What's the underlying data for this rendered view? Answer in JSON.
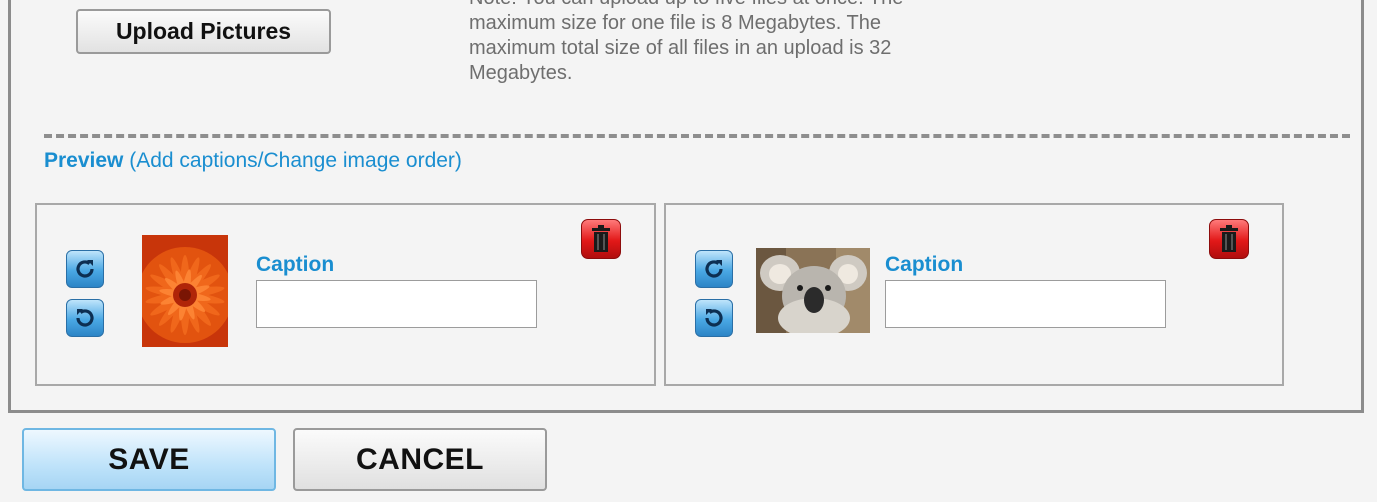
{
  "upload": {
    "button_label": "Upload Pictures",
    "note": "Note: You can upload up to five files at once. The maximum size for one file is 8 Megabytes. The maximum total size of all files in an upload is 32 Megabytes."
  },
  "preview": {
    "title": "Preview",
    "link": "(Add captions/Change image order)",
    "items": [
      {
        "caption_label": "Caption",
        "caption_value": "",
        "image": "red-flower-photo"
      },
      {
        "caption_label": "Caption",
        "caption_value": "",
        "image": "koala-photo"
      }
    ]
  },
  "actions": {
    "save_label": "SAVE",
    "cancel_label": "CANCEL"
  },
  "colors": {
    "accent": "#1a8ed0",
    "rotate_blue": "#3a9ad9",
    "delete_red": "#e21818"
  },
  "icons": [
    "rotate-clockwise-icon",
    "rotate-counterclockwise-icon",
    "trash-icon"
  ]
}
